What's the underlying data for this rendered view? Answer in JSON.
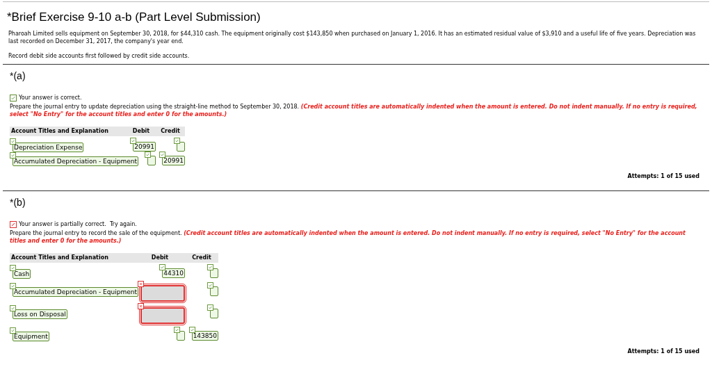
{
  "title": "*Brief Exercise 9-10 a-b (Part Level Submission)",
  "problem": [
    "Pharoah Limited sells equipment on September 30, 2018, for $44,310 cash. The equipment originally cost $143,850 when purchased on January 1, 2016. It has an estimated residual value of $3,910 and a useful life of five years. Depreciation was last recorded on December 31, 2017, the company's year end.",
    "Record debit side accounts first followed by credit side accounts."
  ],
  "parts": [
    {
      "label": "*(a)",
      "feedback": {
        "correct": true,
        "text": "Your answer is correct."
      },
      "instruction": "Prepare the journal entry to update depreciation using the straight-line method to September 30, 2018.",
      "note": "(Credit account titles are automatically indented when the amount is entered. Do not indent manually. If no entry is required, select \"No Entry\" for the account titles and enter 0 for the amounts.)",
      "columns": [
        "Account Titles and Explanation",
        "Debit",
        "Credit"
      ],
      "rows": [
        {
          "account": {
            "value": "Depreciation Expense",
            "correct": true
          },
          "debit": {
            "value": "20991",
            "correct": true
          },
          "credit": {
            "correct": true
          }
        },
        {
          "account": {
            "value": "Accumulated Depreciation - Equipment",
            "correct": true
          },
          "debit": {
            "correct": true
          },
          "credit": {
            "value": "20991",
            "correct": true
          }
        }
      ],
      "attempts": "Attempts: 1 of 15 used"
    },
    {
      "label": "*(b)",
      "feedback": {
        "correct": false,
        "text": "Your answer is partially correct.  Try again."
      },
      "instruction": "Prepare the journal entry to record the sale of the equipment.",
      "note": "(Credit account titles are automatically indented when the amount is entered. Do not indent manually. If no entry is required, select \"No Entry\" for the account titles and enter 0 for the amounts.)",
      "columns": [
        "Account Titles and Explanation",
        "Debit",
        "Credit"
      ],
      "rows": [
        {
          "account": {
            "value": "Cash",
            "correct": true
          },
          "debit": {
            "value": "44310",
            "correct": true
          },
          "credit": {
            "correct": true
          }
        },
        {
          "account": {
            "value": "Accumulated Depreciation - Equipment",
            "correct": true
          },
          "debit": {
            "correct": false
          },
          "credit": {
            "correct": true
          }
        },
        {
          "account": {
            "value": "Loss on Disposal",
            "correct": true
          },
          "debit": {
            "correct": false
          },
          "credit": {
            "correct": true
          }
        },
        {
          "account": {
            "value": "Equipment",
            "correct": true
          },
          "debit": {
            "correct": true
          },
          "credit": {
            "value": "143850",
            "correct": true
          }
        }
      ],
      "attempts": "Attempts: 1 of 15 used"
    }
  ]
}
